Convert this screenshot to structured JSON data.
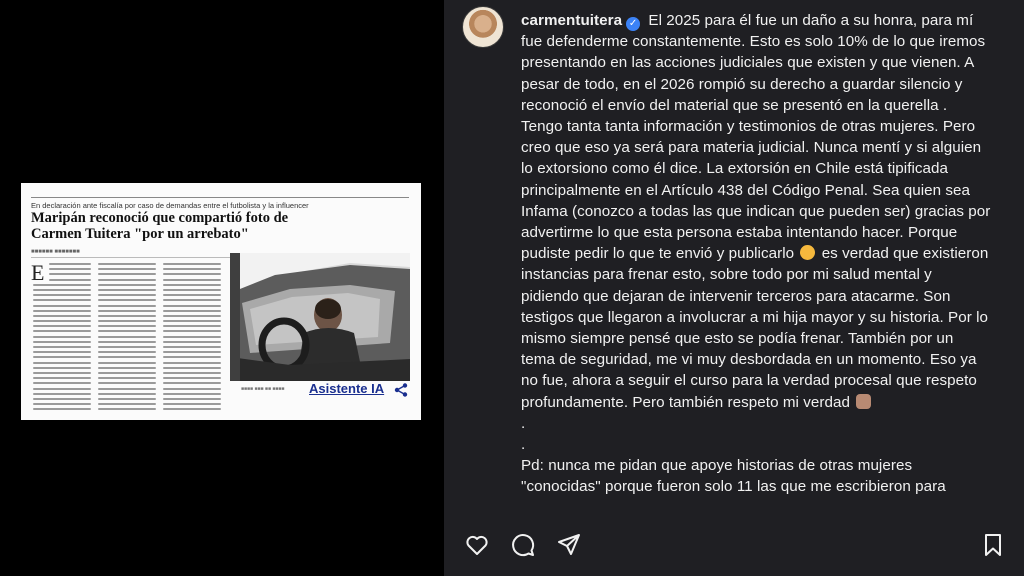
{
  "media": {
    "kicker": "En declaración ante fiscalía por caso de demandas entre el futbolista y la influencer",
    "headline": "Maripán reconoció que compartió foto de Carmen Tuitera \"por un arrebato\"",
    "dropcap": "E",
    "assistant_label": "Asistente IA",
    "share_icon": "share-icon"
  },
  "post": {
    "username": "carmentuitera",
    "verified_icon": "verified-badge-icon",
    "caption_part1": "El 2025 para él fue un daño a su honra, para mí fue defenderme constantemente. Esto es solo 10% de lo que iremos presentando en las acciones judiciales que existen y que vienen. A pesar de todo, en el 2026 rompió su derecho a guardar silencio y reconoció el envío del material que se presentó en la querella . Tengo tanta tanta información y testimonios de otras mujeres. Pero creo que eso ya será para materia judicial. Nunca mentí y si alguien lo extorsiono como él dice. La extorsión en Chile está tipificada principalmente en el Artículo 438 del Código Penal. Sea quien sea Infama (conozco a todas las que indican que pueden ser) gracias por advertirme lo que esta persona estaba intentando hacer. Porque pudiste pedir lo que te envió y publicarlo",
    "caption_part2": "es verdad que existieron instancias para frenar esto, sobre todo por mi salud mental y pidiendo que dejaran de intervenir terceros para atacarme. Son testigos que llegaron a involucrar a mi hija mayor y su historia. Por lo mismo siempre pensé que esto se podía frenar. También por un tema de seguridad, me vi muy desbordada en un momento. Eso ya no fue, ahora a seguir el curso para la verdad procesal que respeto profundamente. Pero también respeto mi verdad",
    "dot1": ".",
    "dot2": ".",
    "ps": "Pd: nunca me pidan que apoye historias de otras mujeres \"conocidas\" porque fueron solo 11 las que me escribieron para"
  },
  "actions": {
    "like_icon": "heart-icon",
    "comment_icon": "comment-icon",
    "share_icon": "send-icon",
    "save_icon": "bookmark-icon"
  }
}
